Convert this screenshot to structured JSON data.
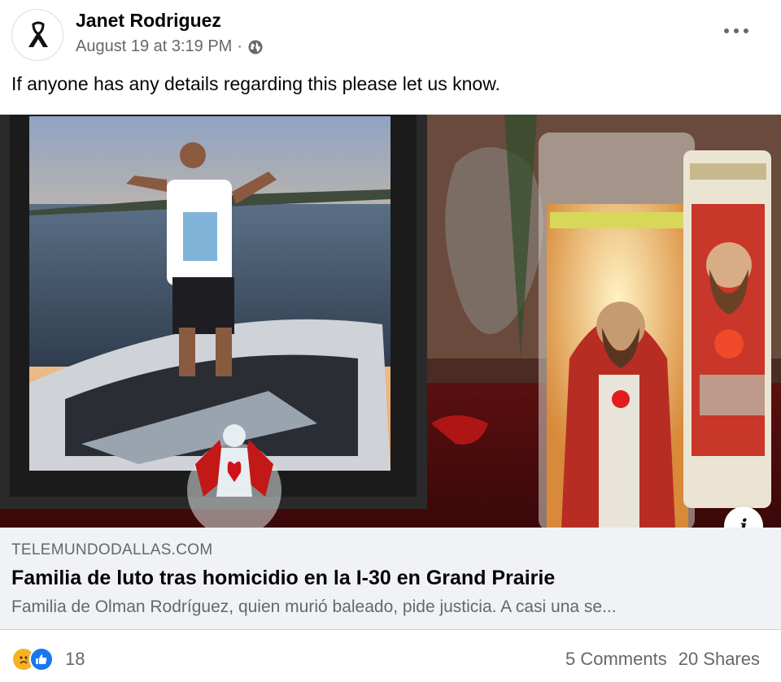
{
  "post": {
    "author": "Janet Rodriguez",
    "timestamp": "August 19 at 3:19 PM",
    "separator": "·",
    "privacy_icon": "globe-icon",
    "caption": "If anyone has any details regarding this please let us know."
  },
  "link_preview": {
    "domain": "TELEMUNDODALLAS.COM",
    "headline": "Familia de luto tras homicidio en la I-30 en Grand Prairie",
    "description": "Familia de Olman Rodríguez, quien murió baleado, pide justicia. A casi una se..."
  },
  "footer": {
    "reaction_count": "18",
    "comments": "5 Comments",
    "shares": "20 Shares"
  },
  "colors": {
    "secondary_text": "#65676b",
    "like_blue": "#1877f2",
    "sad_yellow": "#f7b125",
    "preview_bg": "#f0f2f5"
  }
}
